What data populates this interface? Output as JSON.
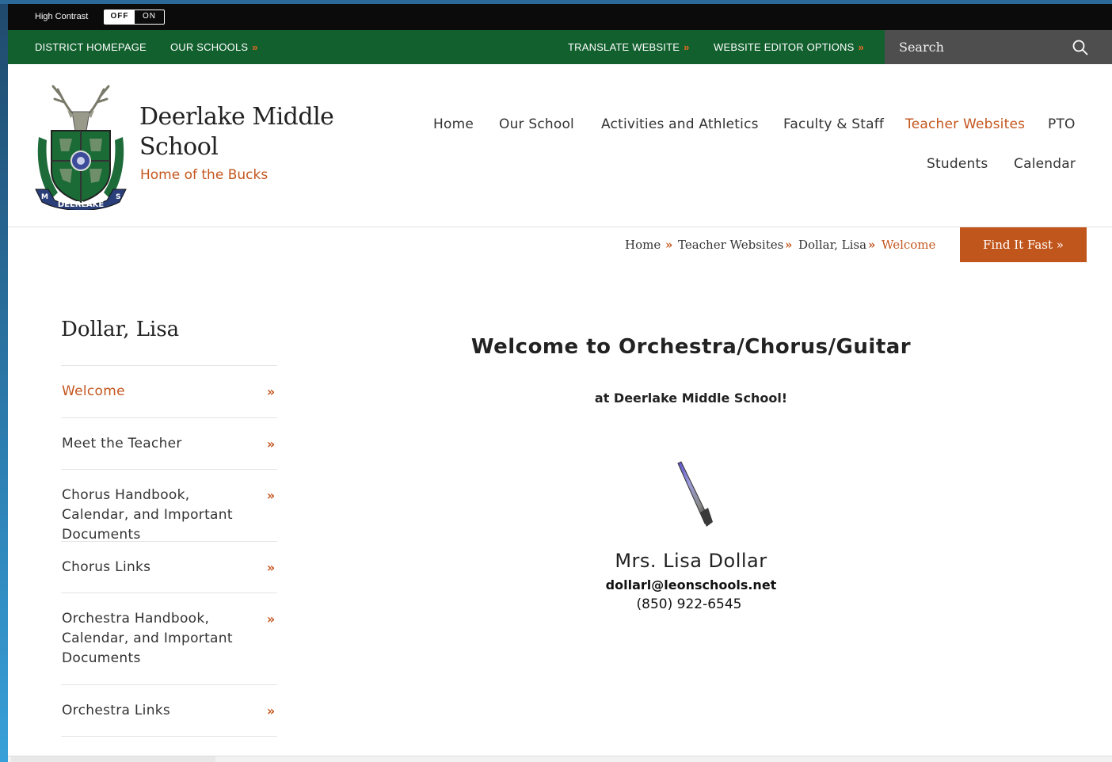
{
  "accessibility": {
    "label": "High Contrast",
    "off": "OFF",
    "on": "ON"
  },
  "utility_nav": {
    "district_homepage": "DISTRICT HOMEPAGE",
    "our_schools": "OUR SCHOOLS",
    "translate": "TRANSLATE WEBSITE",
    "editor_options": "WEBSITE EDITOR OPTIONS",
    "arrow": "»"
  },
  "search": {
    "placeholder": "Search"
  },
  "school": {
    "name": "Deerlake Middle School",
    "tagline": "Home of the Bucks"
  },
  "main_nav": {
    "home": "Home",
    "our_school": "Our School",
    "activities": "Activities and Athletics",
    "faculty": "Faculty & Staff",
    "teacher_websites": "Teacher Websites",
    "pto": "PTO",
    "students": "Students",
    "calendar": "Calendar"
  },
  "breadcrumb": {
    "home": "Home",
    "teacher_websites": "Teacher Websites",
    "teacher": "Dollar, Lisa",
    "current": "Welcome",
    "sep": "»"
  },
  "find_it_fast": "Find It Fast »",
  "sidebar": {
    "title": "Dollar, Lisa",
    "arrow": "»",
    "items": [
      {
        "label": "Welcome"
      },
      {
        "label": "Meet the Teacher"
      },
      {
        "label": "Chorus Handbook, Calendar, and Important Documents"
      },
      {
        "label": "Chorus Links"
      },
      {
        "label": "Orchestra Handbook, Calendar, and Important Documents"
      },
      {
        "label": "Orchestra Links"
      }
    ]
  },
  "content": {
    "title": "Welcome to Orchestra/Chorus/Guitar",
    "subtitle": "at Deerlake Middle School!",
    "teacher_name": "Mrs. Lisa Dollar",
    "email": "dollarl@leonschools.net",
    "phone": "(850) 922-6545"
  },
  "logo_text": {
    "banner": "DEERLAKE",
    "left": "M",
    "right": "S"
  },
  "colors": {
    "green": "#13602f",
    "orange": "#c4561e",
    "button": "#c1561d",
    "dark": "#0b0b0b"
  },
  "icons": {
    "search": "search-icon",
    "logo": "deer-crest-logo",
    "baton": "conductor-baton-image"
  }
}
